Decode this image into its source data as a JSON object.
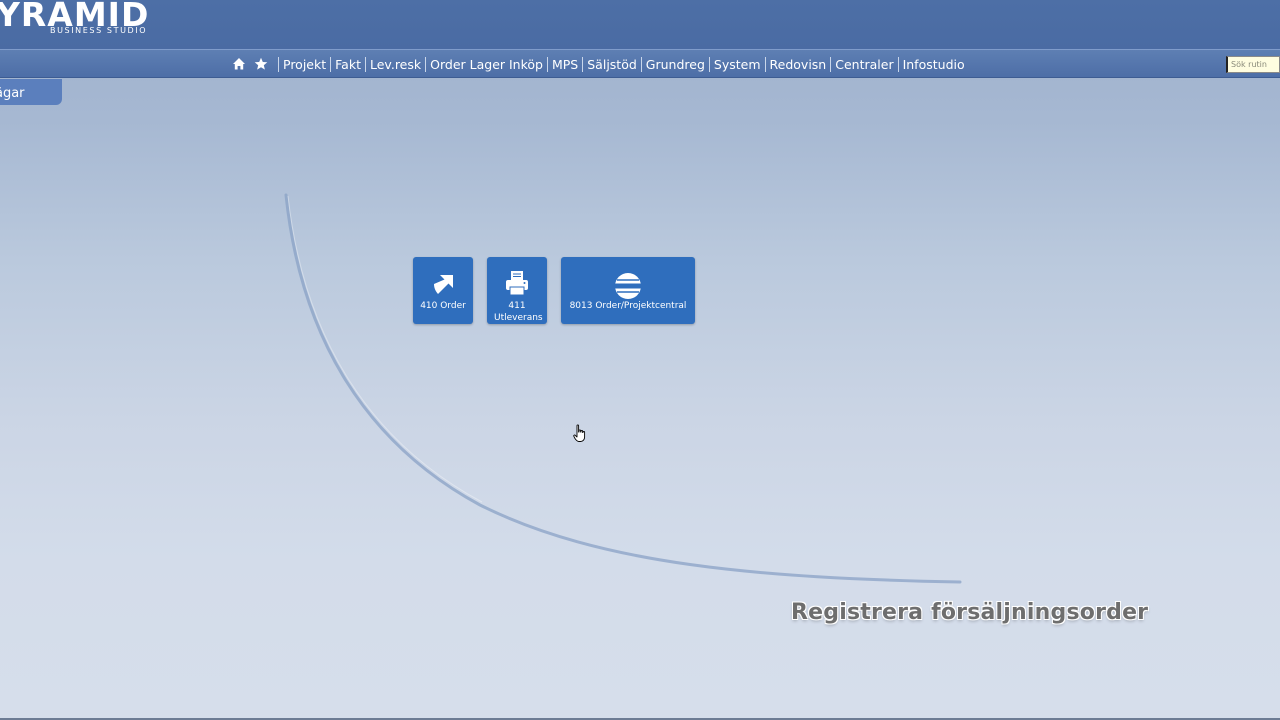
{
  "app": {
    "logo_text": "YRAMID",
    "logo_subtitle": "BUSINESS STUDIO"
  },
  "menubar": {
    "icons": [
      "home-icon",
      "star-icon"
    ],
    "items": [
      {
        "label": "Projekt"
      },
      {
        "label": "Fakt"
      },
      {
        "label": "Lev.resk"
      },
      {
        "label": "Order Lager Inköp"
      },
      {
        "label": "MPS"
      },
      {
        "label": "Säljstöd"
      },
      {
        "label": "Grundreg"
      },
      {
        "label": "System"
      },
      {
        "label": "Redovisn"
      },
      {
        "label": "Centraler"
      },
      {
        "label": "Infostudio"
      }
    ],
    "search": {
      "placeholder": "Sök rutin",
      "value": ""
    }
  },
  "side_tab": {
    "label": "ägar"
  },
  "tiles": [
    {
      "label": "410 Order",
      "icon": "arrow-shortcut-icon"
    },
    {
      "label": "411 Utleverans",
      "icon": "printer-icon"
    },
    {
      "label": "8013 Order/Projektcentral",
      "icon": "central-icon"
    }
  ],
  "caption": "Registrera försäljningsorder",
  "colors": {
    "topbar": "#4a6ba3",
    "menubar": "#5e7fb3",
    "tile": "#2f6ebd",
    "background_top": "#9eb0cc",
    "background_bottom": "#d6deeb"
  }
}
